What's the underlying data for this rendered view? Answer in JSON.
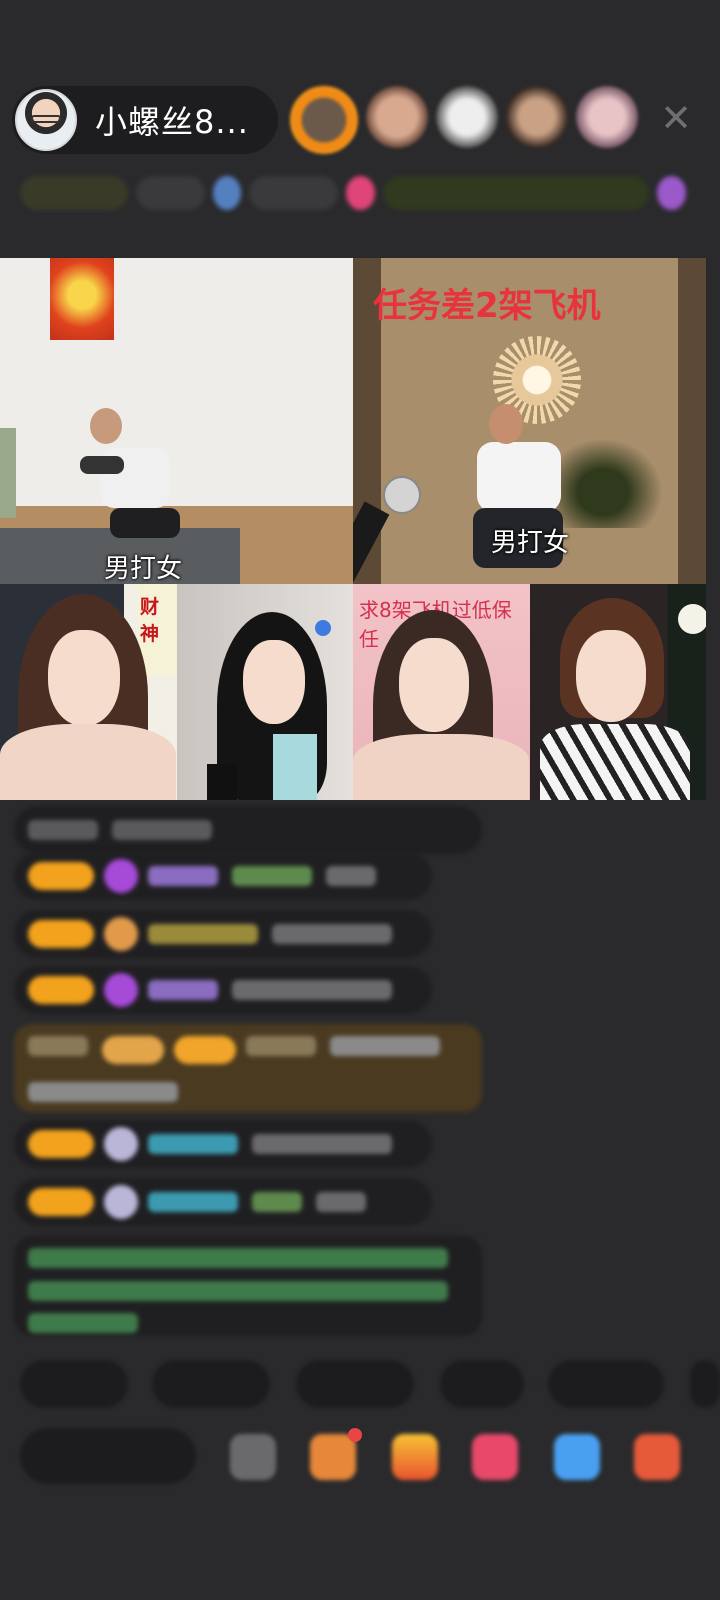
{
  "header": {
    "host_name": "小螺丝8...",
    "close_icon": "close-icon"
  },
  "video_grid": {
    "top_left_label": "男打女",
    "top_right_label": "男打女",
    "top_right_banner": "任务差2架飞机",
    "bottom_left_tag": "财神",
    "bottom_right_mission": "求8架飞机过低保任"
  },
  "colors": {
    "background": "#2a2a2c",
    "badge_gold": "#f2a21c",
    "banner_red": "#e8323c"
  }
}
